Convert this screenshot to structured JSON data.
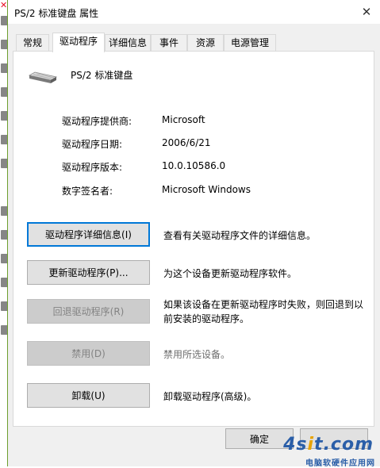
{
  "window": {
    "title": "PS/2 标准键盘 属性"
  },
  "tabs": [
    {
      "label": "常规"
    },
    {
      "label": "驱动程序"
    },
    {
      "label": "详细信息"
    },
    {
      "label": "事件"
    },
    {
      "label": "资源"
    },
    {
      "label": "电源管理"
    }
  ],
  "active_tab": "驱动程序",
  "device": {
    "name": "PS/2 标准键盘",
    "icon": "keyboard-icon"
  },
  "properties": [
    {
      "label": "驱动程序提供商:",
      "value": "Microsoft"
    },
    {
      "label": "驱动程序日期:",
      "value": "2006/6/21"
    },
    {
      "label": "驱动程序版本:",
      "value": "10.0.10586.0"
    },
    {
      "label": "数字签名者:",
      "value": "Microsoft Windows"
    }
  ],
  "actions": [
    {
      "label": "驱动程序详细信息(I)",
      "desc": "查看有关驱动程序文件的详细信息。",
      "enabled": true
    },
    {
      "label": "更新驱动程序(P)...",
      "desc": "为这个设备更新驱动程序软件。",
      "enabled": true
    },
    {
      "label": "回退驱动程序(R)",
      "desc": "如果该设备在更新驱动程序时失败，则回退到以前安装的驱动程序。",
      "enabled": false
    },
    {
      "label": "禁用(D)",
      "desc": "禁用所选设备。",
      "enabled": false
    },
    {
      "label": "卸载(U)",
      "desc": "卸载驱动程序(高级)。",
      "enabled": true
    }
  ],
  "footer": {
    "ok_label": "确定",
    "cancel_label": ""
  },
  "watermark": {
    "logo": "4sit.com",
    "subtitle": "电脑软硬件应用网"
  },
  "colors": {
    "focus": "#0078d7",
    "dialog_bg": "#f0f0f0",
    "button_bg": "#e1e1e1",
    "disabled_text": "#838383"
  }
}
